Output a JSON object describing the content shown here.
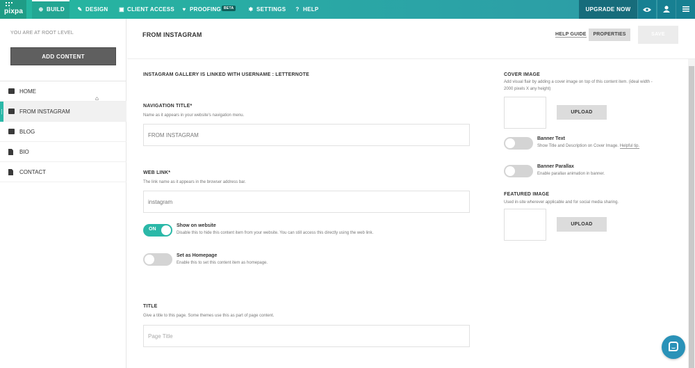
{
  "topbar": {
    "logo": "pixpa",
    "nav": [
      {
        "label": "BUILD",
        "icon": "plus-circle-icon"
      },
      {
        "label": "DESIGN",
        "icon": "brush-icon"
      },
      {
        "label": "CLIENT ACCESS",
        "icon": "lock-icon"
      },
      {
        "label": "PROOFING",
        "icon": "heart-icon"
      },
      {
        "label": "SETTINGS",
        "icon": "gear-icon"
      },
      {
        "label": "HELP",
        "icon": "question-icon"
      }
    ],
    "beta_badge": "BETA",
    "upgrade_label": "UPGRADE NOW",
    "right_icons": [
      "eye-icon",
      "user-icon",
      "menu-icon"
    ]
  },
  "sidebar": {
    "root_label": "YOU ARE AT ROOT LEVEL",
    "add_content_label": "ADD CONTENT",
    "items": [
      {
        "label": "HOME",
        "icon": "gallery-icon",
        "is_home": true
      },
      {
        "label": "FROM INSTAGRAM",
        "icon": "gallery-icon",
        "active": true
      },
      {
        "label": "BLOG",
        "icon": "chat-icon"
      },
      {
        "label": "BIO",
        "icon": "document-icon"
      },
      {
        "label": "CONTACT",
        "icon": "document-icon"
      }
    ]
  },
  "header": {
    "title": "FROM INSTAGRAM",
    "help_guide": "HELP GUIDE",
    "properties": "PROPERTIES",
    "save": "SAVE"
  },
  "form": {
    "linked_text": "INSTAGRAM GALLERY IS LINKED WITH USERNAME : LETTERNOTE",
    "nav_title": {
      "label": "NAVIGATION TITLE*",
      "help": "Name as it appears in your website's navigation menu.",
      "value": "FROM INSTAGRAM"
    },
    "web_link": {
      "label": "WEB LINK*",
      "help": "The link name as it appears in the browser address bar.",
      "value": "instagram"
    },
    "show_on_website": {
      "state": "ON",
      "title": "Show on website",
      "desc": "Disable this to hide this content item from your website. You can still access this directly using the web link."
    },
    "set_homepage": {
      "title": "Set as Homepage",
      "desc": "Enable this to set this content item as homepage."
    },
    "title_field": {
      "label": "TITLE",
      "help": "Give a title to this page. Some themes use this as part of page content.",
      "placeholder": "Page Title"
    }
  },
  "right_panel": {
    "cover_image": {
      "label": "COVER IMAGE",
      "help_line1": "Add visual flair by adding a cover image on top of this content item. (ideal width -",
      "help_line2": "2000 pixels X any height)",
      "upload": "UPLOAD"
    },
    "banner_text": {
      "title": "Banner Text",
      "desc": "Show Title and Description on Cover Image.",
      "tip": "Helpful tip."
    },
    "banner_parallax": {
      "title": "Banner Parallax",
      "desc": "Enable parallax animation in banner."
    },
    "featured_image": {
      "label": "FEATURED IMAGE",
      "help": "Used in-site wherever applicable and for social media sharing.",
      "upload": "UPLOAD"
    }
  },
  "colors": {
    "accent": "#2bb8a8",
    "upgrade_bg": "#176c7b",
    "chat_bg": "#2a92b8"
  }
}
